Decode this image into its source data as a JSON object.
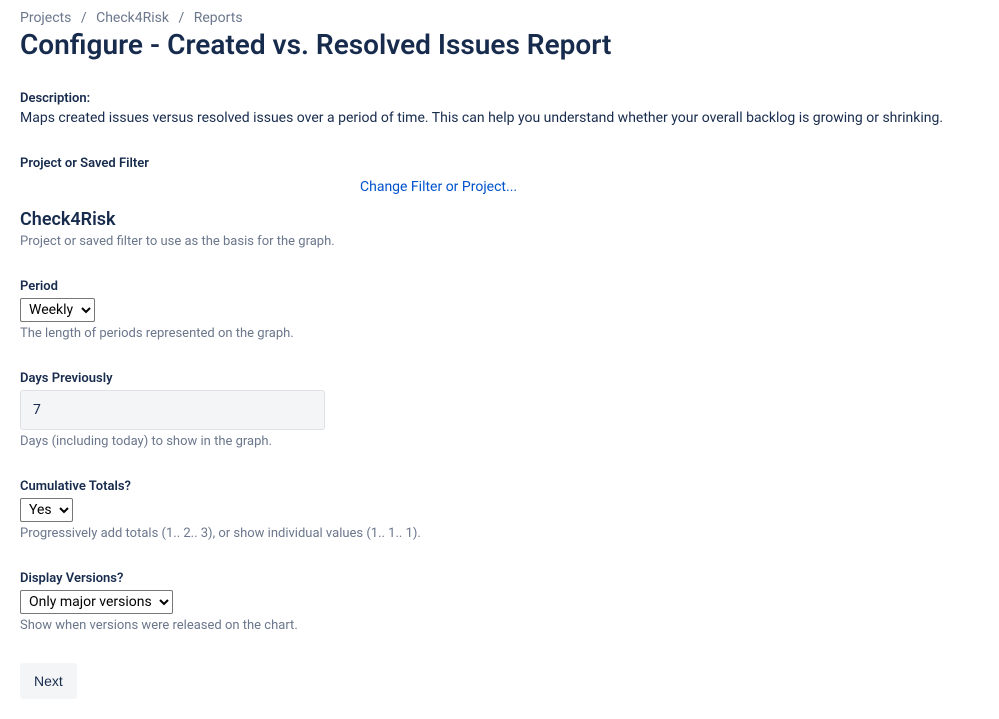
{
  "breadcrumb": {
    "items": [
      "Projects",
      "Check4Risk",
      "Reports"
    ]
  },
  "page_title": "Configure - Created vs. Resolved Issues Report",
  "description": {
    "label": "Description:",
    "text": "Maps created issues versus resolved issues over a period of time. This can help you understand whether your overall backlog is growing or shrinking."
  },
  "filter": {
    "label": "Project or Saved Filter",
    "change_link": "Change Filter or Project...",
    "name": "Check4Risk",
    "help": "Project or saved filter to use as the basis for the graph."
  },
  "period": {
    "label": "Period",
    "value": "Weekly",
    "help": "The length of periods represented on the graph."
  },
  "days_prev": {
    "label": "Days Previously",
    "value": "7",
    "help": "Days (including today) to show in the graph."
  },
  "cumulative": {
    "label": "Cumulative Totals?",
    "value": "Yes",
    "help": "Progressively add totals (1.. 2.. 3), or show individual values (1.. 1.. 1)."
  },
  "versions": {
    "label": "Display Versions?",
    "value": "Only major versions",
    "help": "Show when versions were released on the chart."
  },
  "next_button": "Next"
}
